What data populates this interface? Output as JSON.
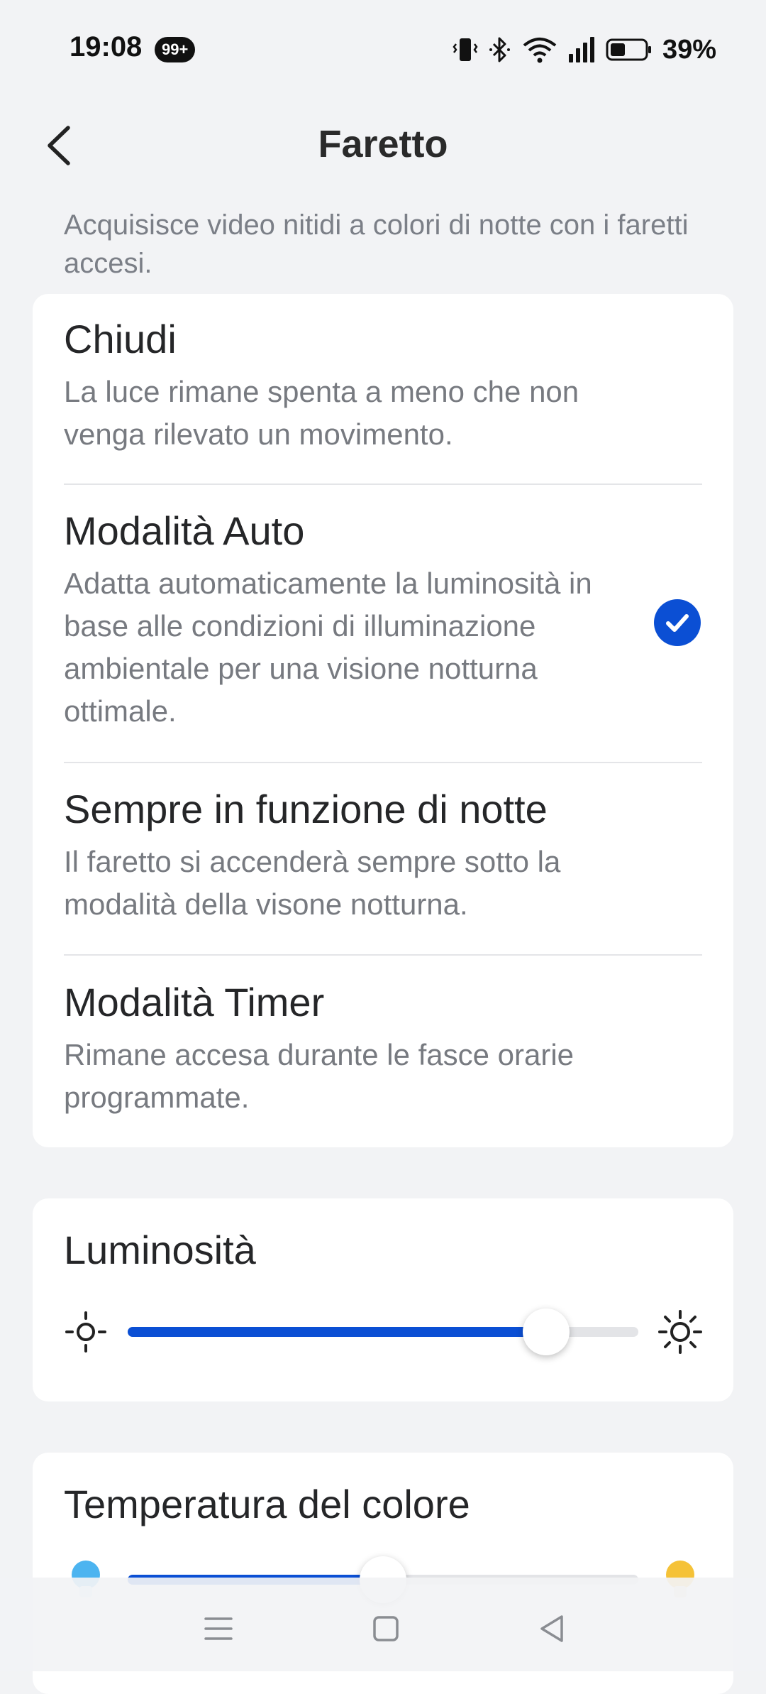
{
  "status_bar": {
    "time": "19:08",
    "notification_badge": "99+",
    "battery_percent": "39%",
    "icons": [
      "vibrate-icon",
      "bluetooth-icon",
      "wifi-icon",
      "signal-icon",
      "battery-icon"
    ]
  },
  "header": {
    "title": "Faretto",
    "back_icon": "chevron-left-icon"
  },
  "intro_text": "Acquisisce video nitidi a colori di notte con i faretti accesi.",
  "modes": {
    "selected": "Modalità Auto",
    "options": [
      {
        "title": "Chiudi",
        "description": "La luce rimane spenta a meno che non venga rilevato un movimento."
      },
      {
        "title": "Modalità Auto",
        "description": "Adatta automaticamente la luminosità in base alle condizioni di illuminazione ambientale per una visione notturna ottimale."
      },
      {
        "title": "Sempre in funzione di notte",
        "description": "Il faretto si accenderà sempre sotto la modalità della visone notturna."
      },
      {
        "title": "Modalità Timer",
        "description": "Rimane accesa durante le fasce orarie programmate."
      }
    ]
  },
  "brightness": {
    "title": "Luminosità",
    "value_fraction": 0.82,
    "min_icon": "sun-low-icon",
    "max_icon": "sun-high-icon"
  },
  "color_temperature": {
    "title": "Temperatura del colore",
    "value_fraction": 0.5,
    "min_icon": "cool-bulb-icon",
    "max_icon": "warm-bulb-icon"
  },
  "colors": {
    "accent": "#0b4fd4",
    "background": "#f2f3f5",
    "card": "#ffffff"
  },
  "nav_bar": {
    "icons": [
      "menu-icon",
      "home-icon",
      "back-icon"
    ]
  }
}
